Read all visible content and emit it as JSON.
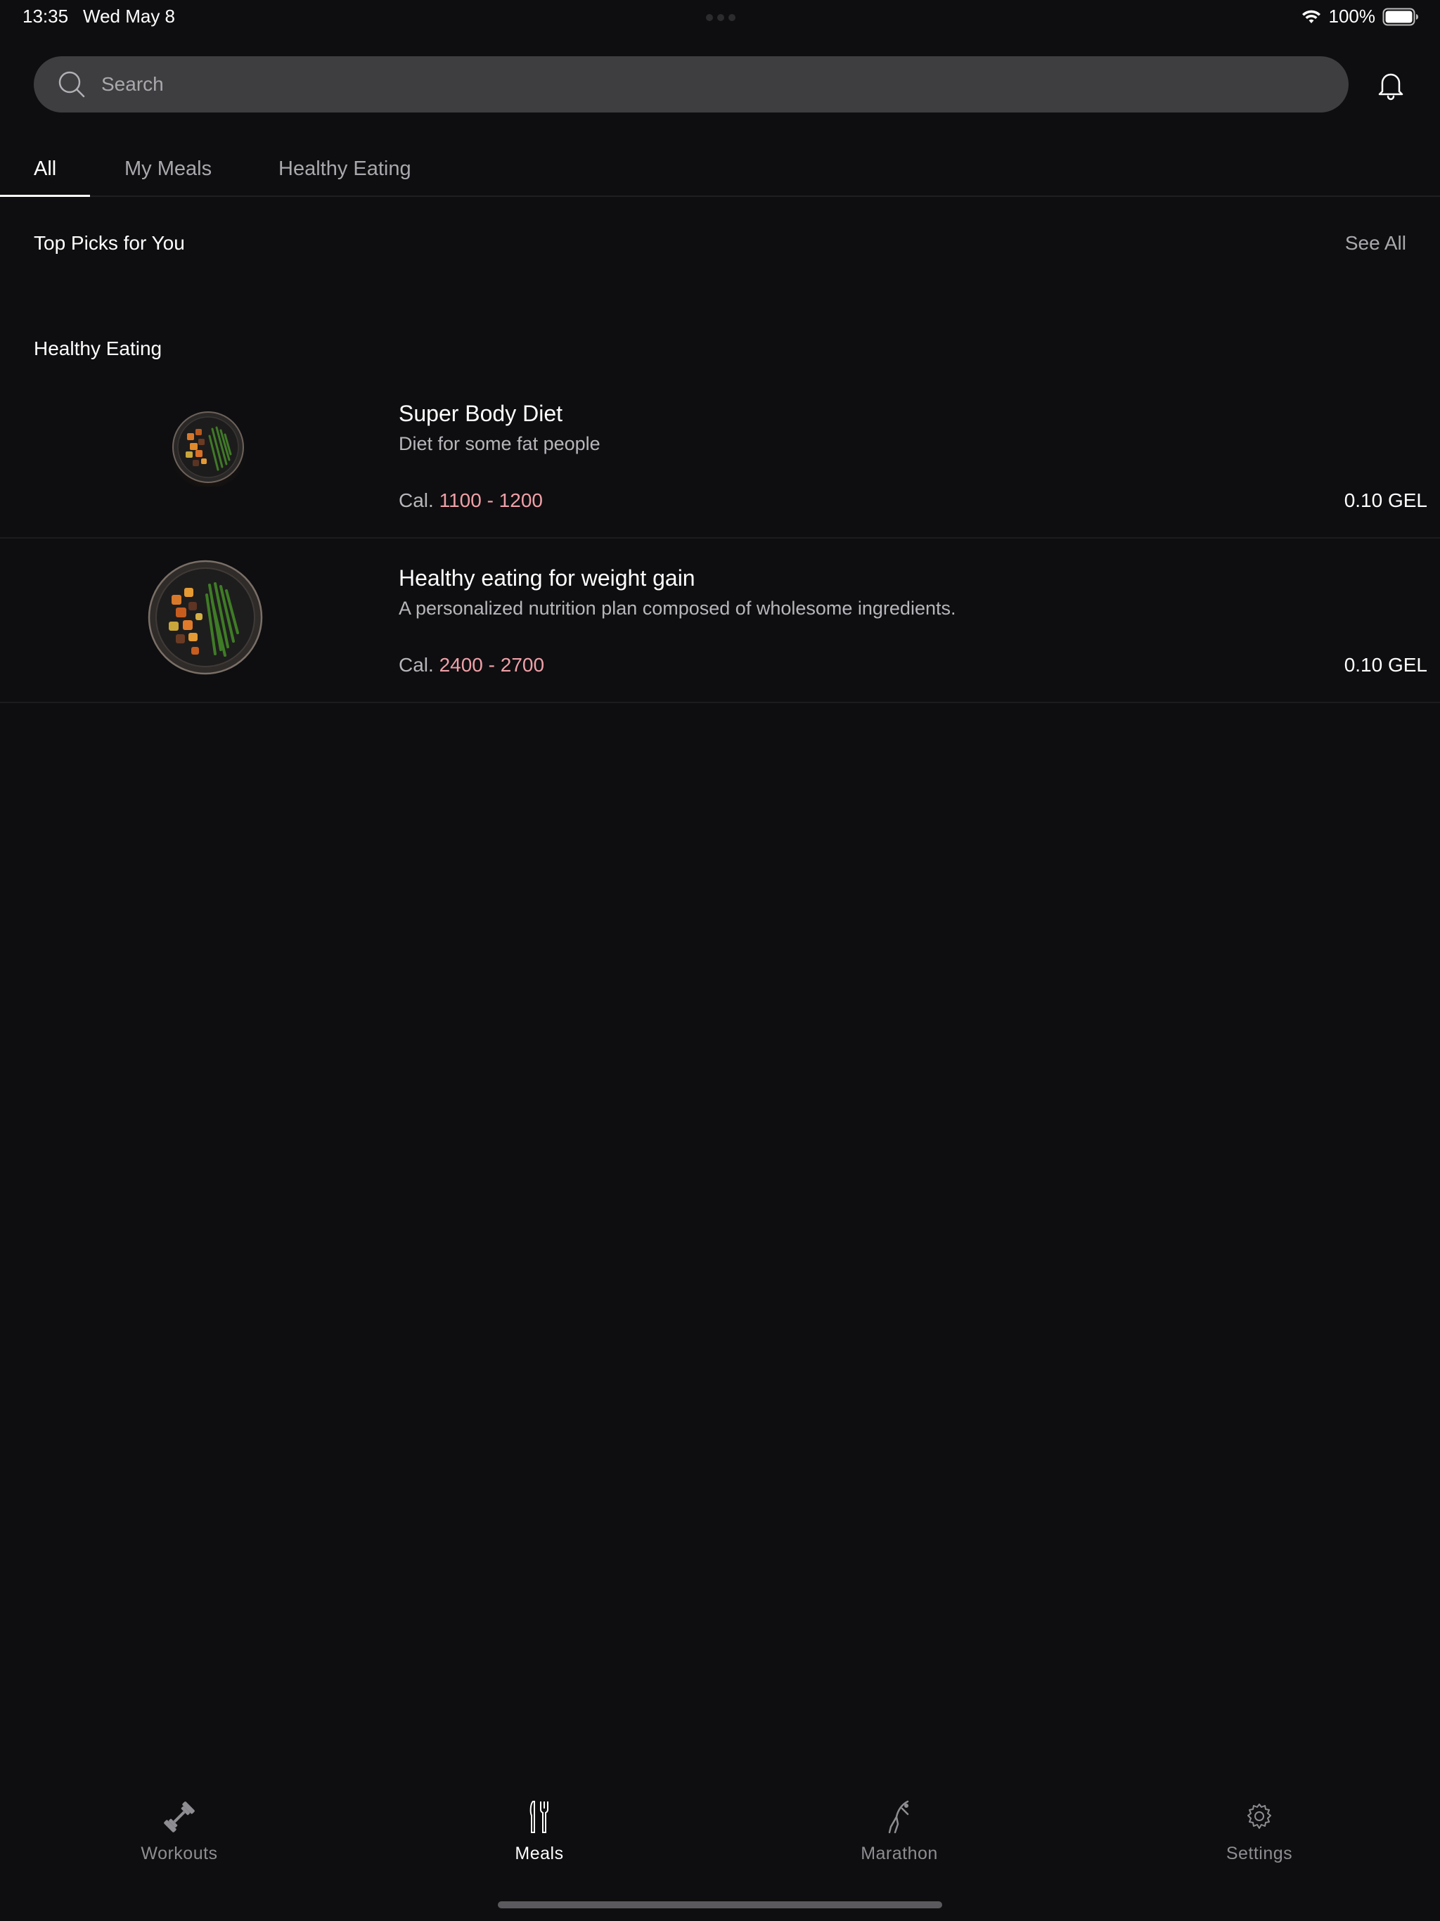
{
  "status_bar": {
    "time": "13:35",
    "date": "Wed May 8",
    "battery": "100%"
  },
  "search": {
    "placeholder": "Search",
    "value": ""
  },
  "tabs": [
    {
      "label": "All",
      "active": true
    },
    {
      "label": "My Meals",
      "active": false
    },
    {
      "label": "Healthy Eating",
      "active": false
    }
  ],
  "top_picks": {
    "title": "Top Picks for You",
    "see_all": "See All"
  },
  "healthy_eating": {
    "title": "Healthy Eating",
    "items": [
      {
        "name": "Super Body Diet",
        "description": "Diet for some fat people",
        "cal_label": "Cal.",
        "cal_range": "1100 - 1200",
        "price": "0.10 GEL",
        "image_icon": "meal-plate-image"
      },
      {
        "name": "Healthy eating for weight gain",
        "description": "A personalized nutrition plan composed of wholesome ingredients.",
        "cal_label": "Cal.",
        "cal_range": "2400 - 2700",
        "price": "0.10 GEL",
        "image_icon": "meal-plate-image"
      }
    ]
  },
  "bottom_nav": [
    {
      "label": "Workouts",
      "icon": "dumbbell-icon",
      "active": false
    },
    {
      "label": "Meals",
      "icon": "fork-knife-icon",
      "active": true
    },
    {
      "label": "Marathon",
      "icon": "runner-icon",
      "active": false
    },
    {
      "label": "Settings",
      "icon": "gear-icon",
      "active": false
    }
  ],
  "colors": {
    "background": "#0e0e10",
    "search_bg": "#3e3e40",
    "accent_calories": "#f0a0a8",
    "secondary_text": "#a8a8ad"
  }
}
